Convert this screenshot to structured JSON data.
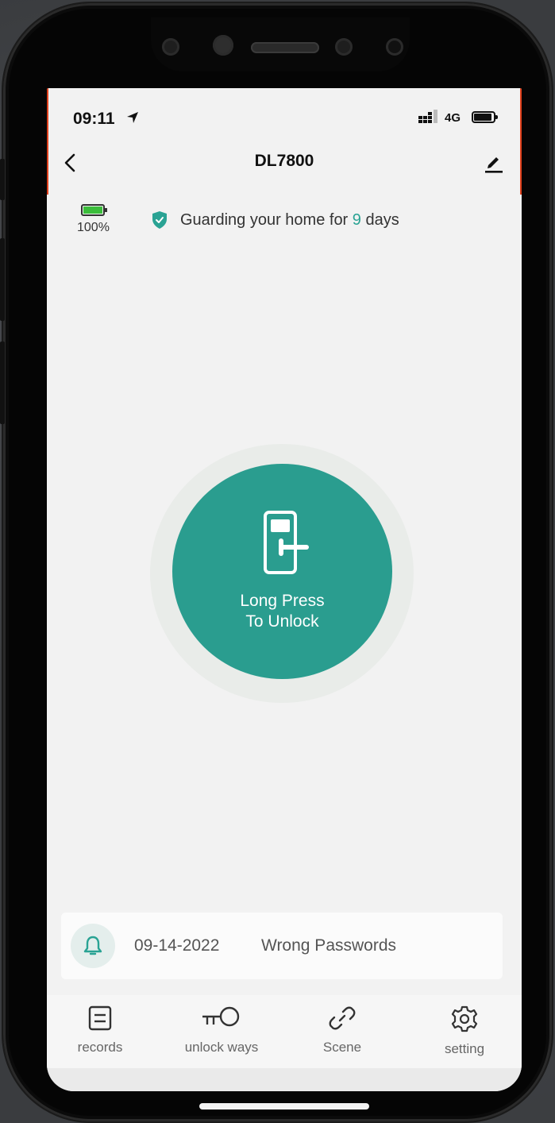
{
  "status_bar": {
    "time": "09:11",
    "network": "4G",
    "icons": [
      "location-arrow-icon",
      "signal-icon",
      "battery-icon"
    ]
  },
  "header": {
    "title": "DL7800",
    "back_icon": "chevron-left-icon",
    "edit_icon": "pencil-icon"
  },
  "lock_status": {
    "battery_percent": "100%",
    "battery_level": 1.0,
    "guard_prefix": "Guarding your home for",
    "guard_days": "9",
    "guard_suffix": "days",
    "shield_icon": "shield-check-icon"
  },
  "unlock_button": {
    "line1": "Long Press",
    "line2": "To Unlock",
    "icon": "door-lock-icon"
  },
  "notification": {
    "date": "09-14-2022",
    "message": "Wrong Passwords",
    "icon": "bell-icon"
  },
  "tabs": [
    {
      "label": "records",
      "icon": "records-icon"
    },
    {
      "label": "unlock ways",
      "icon": "key-icon"
    },
    {
      "label": "Scene",
      "icon": "link-icon"
    },
    {
      "label": "setting",
      "icon": "gear-icon"
    }
  ],
  "colors": {
    "accent": "#2a9d8f",
    "days_highlight": "#2aa394",
    "battery_green": "#3bbd3b",
    "background": "#f2f2f2"
  }
}
